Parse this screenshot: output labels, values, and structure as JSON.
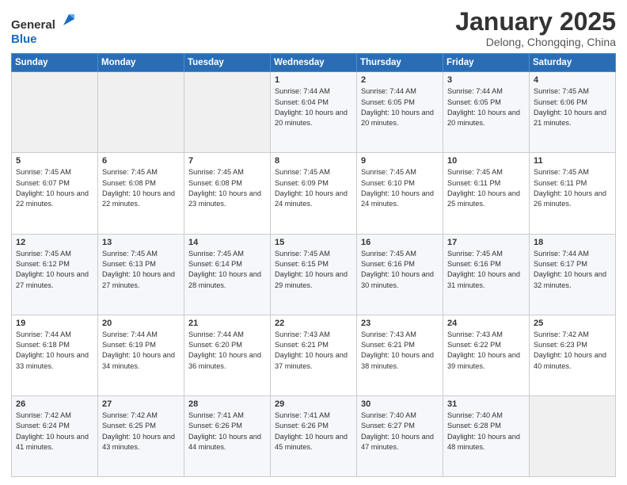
{
  "header": {
    "logo_general": "General",
    "logo_blue": "Blue",
    "month_title": "January 2025",
    "location": "Delong, Chongqing, China"
  },
  "days_of_week": [
    "Sunday",
    "Monday",
    "Tuesday",
    "Wednesday",
    "Thursday",
    "Friday",
    "Saturday"
  ],
  "weeks": [
    [
      {
        "day": "",
        "text": ""
      },
      {
        "day": "",
        "text": ""
      },
      {
        "day": "",
        "text": ""
      },
      {
        "day": "1",
        "text": "Sunrise: 7:44 AM\nSunset: 6:04 PM\nDaylight: 10 hours and 20 minutes."
      },
      {
        "day": "2",
        "text": "Sunrise: 7:44 AM\nSunset: 6:05 PM\nDaylight: 10 hours and 20 minutes."
      },
      {
        "day": "3",
        "text": "Sunrise: 7:44 AM\nSunset: 6:05 PM\nDaylight: 10 hours and 20 minutes."
      },
      {
        "day": "4",
        "text": "Sunrise: 7:45 AM\nSunset: 6:06 PM\nDaylight: 10 hours and 21 minutes."
      }
    ],
    [
      {
        "day": "5",
        "text": "Sunrise: 7:45 AM\nSunset: 6:07 PM\nDaylight: 10 hours and 22 minutes."
      },
      {
        "day": "6",
        "text": "Sunrise: 7:45 AM\nSunset: 6:08 PM\nDaylight: 10 hours and 22 minutes."
      },
      {
        "day": "7",
        "text": "Sunrise: 7:45 AM\nSunset: 6:08 PM\nDaylight: 10 hours and 23 minutes."
      },
      {
        "day": "8",
        "text": "Sunrise: 7:45 AM\nSunset: 6:09 PM\nDaylight: 10 hours and 24 minutes."
      },
      {
        "day": "9",
        "text": "Sunrise: 7:45 AM\nSunset: 6:10 PM\nDaylight: 10 hours and 24 minutes."
      },
      {
        "day": "10",
        "text": "Sunrise: 7:45 AM\nSunset: 6:11 PM\nDaylight: 10 hours and 25 minutes."
      },
      {
        "day": "11",
        "text": "Sunrise: 7:45 AM\nSunset: 6:11 PM\nDaylight: 10 hours and 26 minutes."
      }
    ],
    [
      {
        "day": "12",
        "text": "Sunrise: 7:45 AM\nSunset: 6:12 PM\nDaylight: 10 hours and 27 minutes."
      },
      {
        "day": "13",
        "text": "Sunrise: 7:45 AM\nSunset: 6:13 PM\nDaylight: 10 hours and 27 minutes."
      },
      {
        "day": "14",
        "text": "Sunrise: 7:45 AM\nSunset: 6:14 PM\nDaylight: 10 hours and 28 minutes."
      },
      {
        "day": "15",
        "text": "Sunrise: 7:45 AM\nSunset: 6:15 PM\nDaylight: 10 hours and 29 minutes."
      },
      {
        "day": "16",
        "text": "Sunrise: 7:45 AM\nSunset: 6:16 PM\nDaylight: 10 hours and 30 minutes."
      },
      {
        "day": "17",
        "text": "Sunrise: 7:45 AM\nSunset: 6:16 PM\nDaylight: 10 hours and 31 minutes."
      },
      {
        "day": "18",
        "text": "Sunrise: 7:44 AM\nSunset: 6:17 PM\nDaylight: 10 hours and 32 minutes."
      }
    ],
    [
      {
        "day": "19",
        "text": "Sunrise: 7:44 AM\nSunset: 6:18 PM\nDaylight: 10 hours and 33 minutes."
      },
      {
        "day": "20",
        "text": "Sunrise: 7:44 AM\nSunset: 6:19 PM\nDaylight: 10 hours and 34 minutes."
      },
      {
        "day": "21",
        "text": "Sunrise: 7:44 AM\nSunset: 6:20 PM\nDaylight: 10 hours and 36 minutes."
      },
      {
        "day": "22",
        "text": "Sunrise: 7:43 AM\nSunset: 6:21 PM\nDaylight: 10 hours and 37 minutes."
      },
      {
        "day": "23",
        "text": "Sunrise: 7:43 AM\nSunset: 6:21 PM\nDaylight: 10 hours and 38 minutes."
      },
      {
        "day": "24",
        "text": "Sunrise: 7:43 AM\nSunset: 6:22 PM\nDaylight: 10 hours and 39 minutes."
      },
      {
        "day": "25",
        "text": "Sunrise: 7:42 AM\nSunset: 6:23 PM\nDaylight: 10 hours and 40 minutes."
      }
    ],
    [
      {
        "day": "26",
        "text": "Sunrise: 7:42 AM\nSunset: 6:24 PM\nDaylight: 10 hours and 41 minutes."
      },
      {
        "day": "27",
        "text": "Sunrise: 7:42 AM\nSunset: 6:25 PM\nDaylight: 10 hours and 43 minutes."
      },
      {
        "day": "28",
        "text": "Sunrise: 7:41 AM\nSunset: 6:26 PM\nDaylight: 10 hours and 44 minutes."
      },
      {
        "day": "29",
        "text": "Sunrise: 7:41 AM\nSunset: 6:26 PM\nDaylight: 10 hours and 45 minutes."
      },
      {
        "day": "30",
        "text": "Sunrise: 7:40 AM\nSunset: 6:27 PM\nDaylight: 10 hours and 47 minutes."
      },
      {
        "day": "31",
        "text": "Sunrise: 7:40 AM\nSunset: 6:28 PM\nDaylight: 10 hours and 48 minutes."
      },
      {
        "day": "",
        "text": ""
      }
    ]
  ]
}
